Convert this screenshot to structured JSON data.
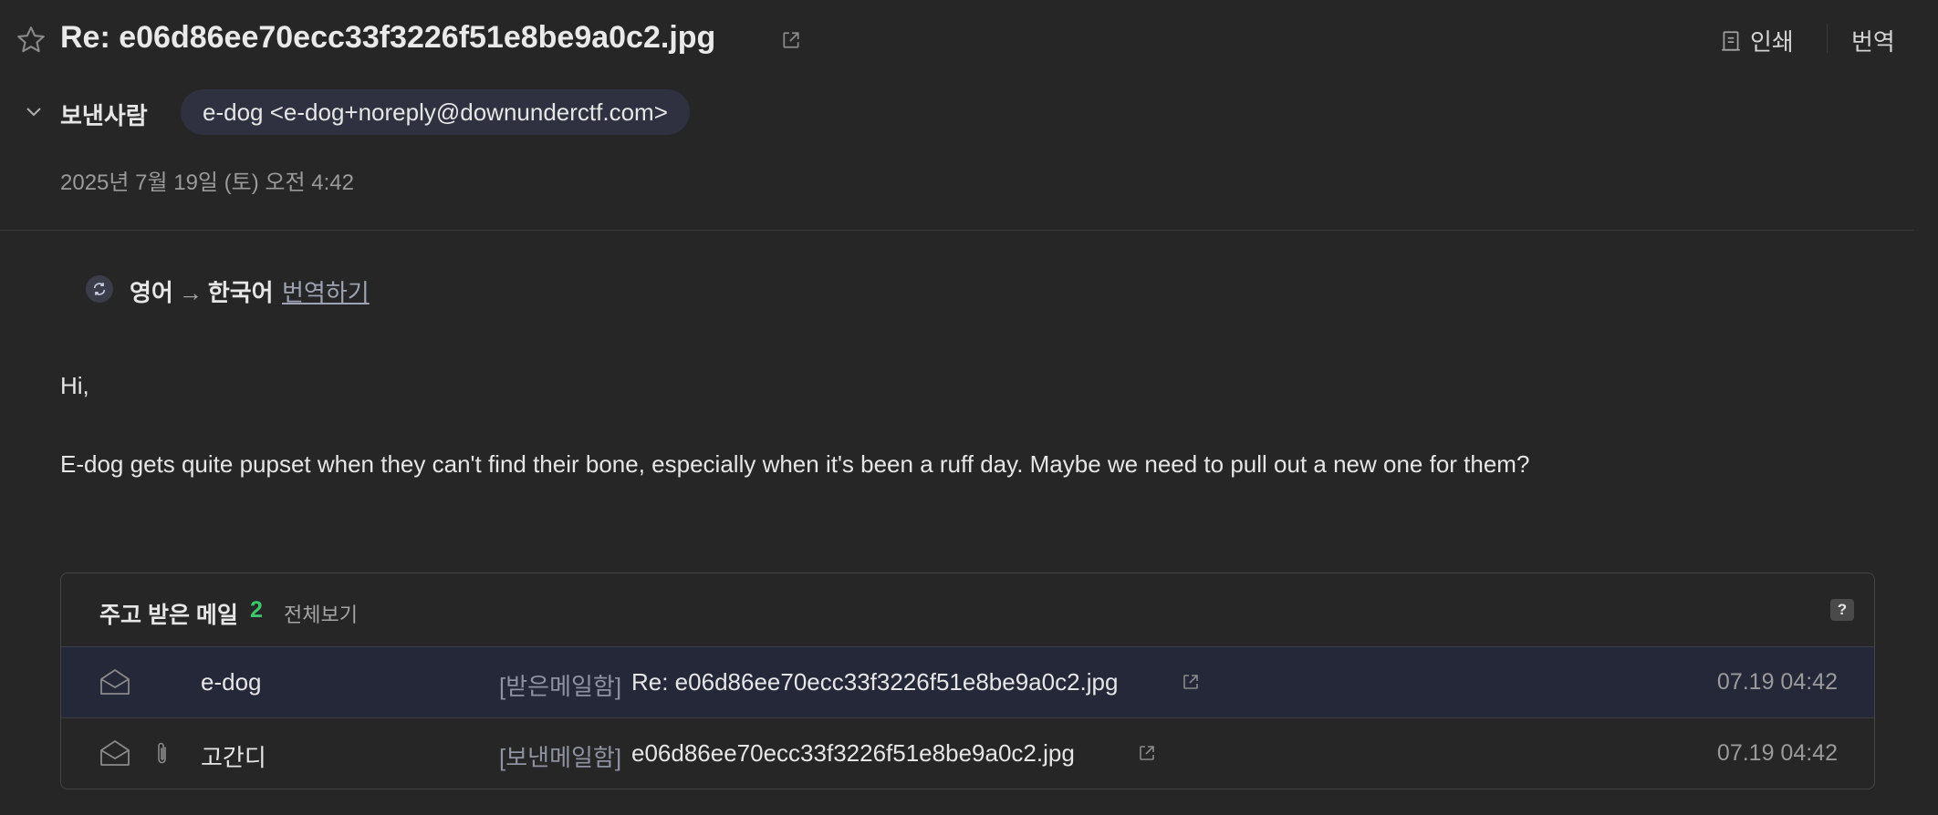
{
  "header": {
    "subject": "Re: e06d86ee70ecc33f3226f51e8be9a0c2.jpg",
    "print_label": "인쇄",
    "translate_label": "번역"
  },
  "sender": {
    "label": "보낸사람",
    "address": "e-dog <e-dog+noreply@downunderctf.com>",
    "date": "2025년 7월 19일 (토) 오전 4:42"
  },
  "translate_bar": {
    "source_lang": "영어",
    "arrow": "→",
    "target_lang": "한국어",
    "action_label": "번역하기"
  },
  "body": {
    "greeting": "Hi,",
    "paragraph": "E-dog gets quite pupset when they can't find their bone, especially when it's been a ruff day. Maybe we need to pull out a new one for them?"
  },
  "thread": {
    "title": "주고 받은 메일",
    "count": "2",
    "view_all": "전체보기",
    "help": "?",
    "rows": [
      {
        "sender": "e-dog",
        "folder": "[받은메일함]",
        "subject": "Re: e06d86ee70ecc33f3226f51e8be9a0c2.jpg",
        "time": "07.19 04:42",
        "has_attachment": false
      },
      {
        "sender": "고간디",
        "folder": "[보낸메일함]",
        "subject": "e06d86ee70ecc33f3226f51e8be9a0c2.jpg",
        "time": "07.19 04:42",
        "has_attachment": true
      }
    ]
  },
  "icons": {
    "star": "star-icon",
    "external": "external-link-icon",
    "print": "print-icon",
    "chevron": "chevron-down-icon",
    "translate": "translate-icon",
    "envelope": "envelope-open-icon",
    "attachment": "paperclip-icon"
  },
  "colors": {
    "background": "#262626",
    "chip": "#2f3140",
    "selected_row": "#252839",
    "count_green": "#3cc76a",
    "link": "#9ea3b4"
  }
}
